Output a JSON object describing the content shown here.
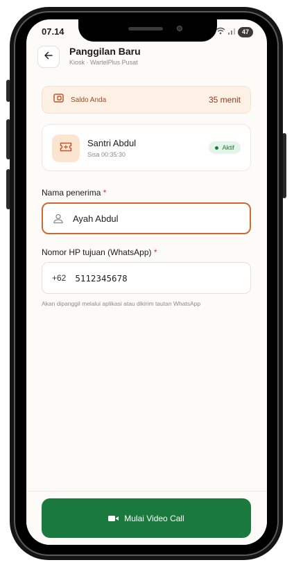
{
  "status_bar": {
    "time": "07.14",
    "battery": "47"
  },
  "header": {
    "title": "Panggilan Baru",
    "subtitle": "Kiosk · WartelPlus Pusat"
  },
  "saldo": {
    "label": "Saldo Anda",
    "value": "35 menit"
  },
  "santri": {
    "name": "Santri Abdul",
    "remaining": "Sisa 00:35:30",
    "status": "Aktif"
  },
  "form": {
    "receiver_label": "Nama penerima",
    "receiver_value": "Ayah Abdul",
    "phone_label": "Nomor HP tujuan (WhatsApp)",
    "phone_prefix": "+62",
    "phone_value": "5112345678",
    "required_mark": "*",
    "hint": "Akan dipanggil melalui aplikasi atau dikirim tautan WhatsApp"
  },
  "cta": {
    "label": "Mulai Video Call"
  },
  "colors": {
    "accent": "#c96a31",
    "primary_green": "#1a7a3d",
    "saldo_bg": "#fdf1e6",
    "badge_bg": "#e5f4e8"
  },
  "icons": [
    "arrow-left-icon",
    "wallet-icon",
    "ticket-icon",
    "user-icon",
    "video-camera-icon",
    "wifi-icon",
    "signal-icon"
  ]
}
